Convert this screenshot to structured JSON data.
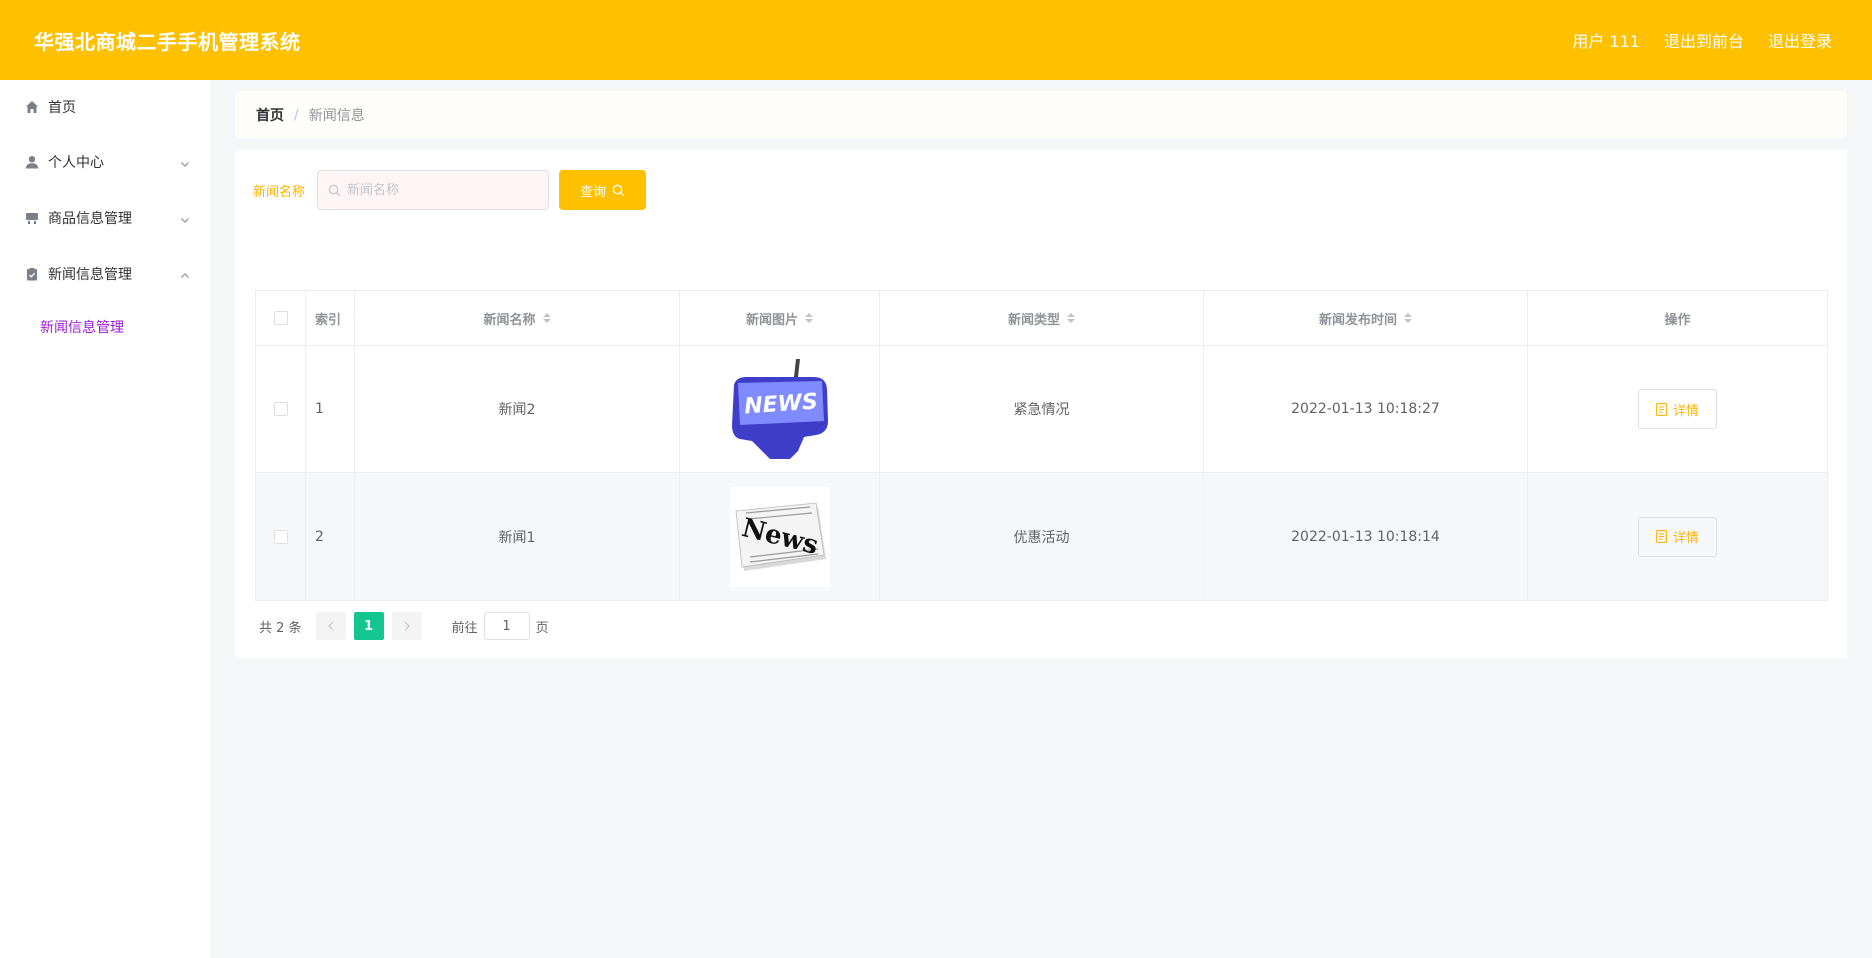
{
  "app": {
    "title": "华强北商城二手手机管理系统"
  },
  "header": {
    "user_label": "用户 111",
    "front_label": "退出到前台",
    "logout_label": "退出登录"
  },
  "sidebar": {
    "items": [
      {
        "label": "首页",
        "icon": "home-icon"
      },
      {
        "label": "个人中心",
        "icon": "user-icon"
      },
      {
        "label": "商品信息管理",
        "icon": "goods-icon"
      },
      {
        "label": "新闻信息管理",
        "icon": "clipboard-icon"
      }
    ],
    "submenu": {
      "label": "新闻信息管理"
    }
  },
  "breadcrumb": {
    "home": "首页",
    "separator": "/",
    "current": "新闻信息"
  },
  "search": {
    "label": "新闻名称",
    "placeholder": "新闻名称",
    "value": "",
    "button_label": "查询"
  },
  "table": {
    "headers": {
      "index": "索引",
      "name": "新闻名称",
      "image": "新闻图片",
      "type": "新闻类型",
      "time": "新闻发布时间",
      "operation": "操作"
    },
    "rows": [
      {
        "index": "1",
        "name": "新闻2",
        "image_text": "NEWS",
        "type": "紧急情况",
        "time": "2022-01-13 10:18:27",
        "action": "详情"
      },
      {
        "index": "2",
        "name": "新闻1",
        "image_text": "News",
        "type": "优惠活动",
        "time": "2022-01-13 10:18:14",
        "action": "详情"
      }
    ]
  },
  "pagination": {
    "total_text": "共 2 条",
    "current_page": "1",
    "goto_label": "前往",
    "goto_value": "1",
    "page_suffix": "页"
  },
  "colors": {
    "primary": "#ffc000",
    "accent_text": "#ffb400",
    "submenu_active": "#9c1bd6",
    "page_active": "#13c58f"
  }
}
